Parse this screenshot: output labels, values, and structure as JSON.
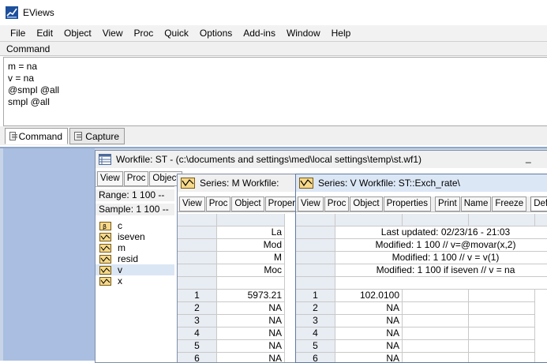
{
  "app": {
    "title": "EViews"
  },
  "menu": [
    "File",
    "Edit",
    "Object",
    "View",
    "Proc",
    "Quick",
    "Options",
    "Add-ins",
    "Window",
    "Help"
  ],
  "command": {
    "label": "Command",
    "lines": [
      "m = na",
      "v = na",
      "@smpl @all",
      "smpl @all"
    ]
  },
  "tabs": {
    "command": "Command",
    "capture": "Capture"
  },
  "workfile": {
    "title": "Workfile: ST - (c:\\documents and settings\\med\\local settings\\temp\\st.wf1)",
    "close_glyph": "_",
    "toolbar": [
      "View",
      "Proc",
      "Object"
    ],
    "range": "Range:  1 100   --",
    "sample": "Sample: 1 100   --",
    "objects": [
      {
        "name": "c",
        "icon": "coef-icon"
      },
      {
        "name": "iseven",
        "icon": "series-icon"
      },
      {
        "name": "m",
        "icon": "series-icon"
      },
      {
        "name": "resid",
        "icon": "series-icon"
      },
      {
        "name": "v",
        "icon": "series-icon"
      },
      {
        "name": "x",
        "icon": "series-icon"
      }
    ]
  },
  "series_m": {
    "title": "Series: M    Workfile:",
    "toolbar": [
      "View",
      "Proc",
      "Object",
      "Properti"
    ],
    "header_lines": [
      "La",
      "Mod",
      "M",
      "Moc"
    ],
    "rows": [
      {
        "obs": "1",
        "value": "5973.21"
      },
      {
        "obs": "2",
        "value": "NA"
      },
      {
        "obs": "3",
        "value": "NA"
      },
      {
        "obs": "4",
        "value": "NA"
      },
      {
        "obs": "5",
        "value": "NA"
      },
      {
        "obs": "6",
        "value": "NA"
      }
    ]
  },
  "series_v": {
    "title": "Series: V    Workfile: ST::Exch_rate\\",
    "toolbar": [
      "View",
      "Proc",
      "Object",
      "Properties",
      "Print",
      "Name",
      "Freeze",
      "Default"
    ],
    "header_lines": [
      "Last updated: 02/23/16 - 21:03",
      "Modified: 1 100 // v=@movar(x,2)",
      "Modified: 1 100 // v = v(1)",
      "Modified: 1 100 if iseven // v = na"
    ],
    "rows": [
      {
        "obs": "1",
        "value": "102.0100"
      },
      {
        "obs": "2",
        "value": "NA"
      },
      {
        "obs": "3",
        "value": "NA"
      },
      {
        "obs": "4",
        "value": "NA"
      },
      {
        "obs": "5",
        "value": "NA"
      },
      {
        "obs": "6",
        "value": "NA"
      }
    ]
  }
}
